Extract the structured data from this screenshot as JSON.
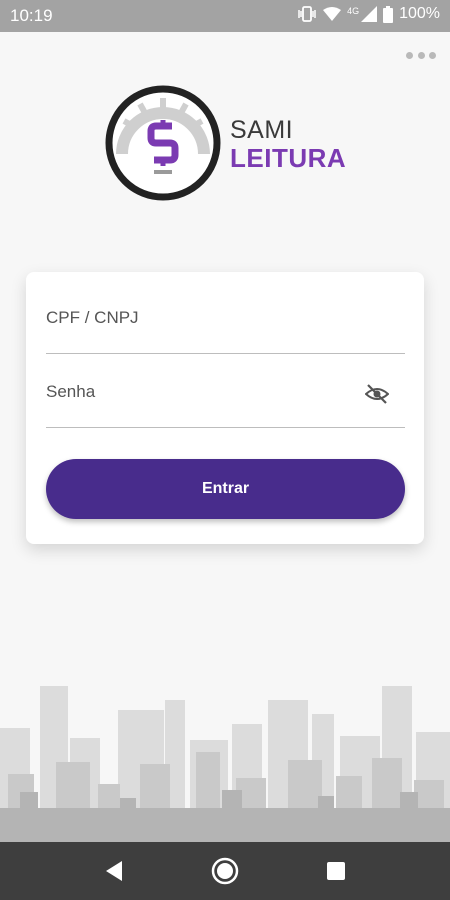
{
  "status_bar": {
    "time": "10:19",
    "network_label": "4G",
    "battery_percent": "100%",
    "icons": [
      "vibrate-icon",
      "wifi-icon",
      "signal-icon",
      "battery-icon"
    ]
  },
  "toolbar": {
    "overflow_icon": "more-horiz-icon"
  },
  "logo": {
    "line1": "SAMI",
    "line2": "LEITURA",
    "icon": "meter-dollar-icon",
    "colors": {
      "primary": "#7b3bb2",
      "ring": "#222222"
    }
  },
  "login": {
    "cpf_placeholder": "CPF / CNPJ",
    "password_placeholder": "Senha",
    "password_toggle_icon": "eye-off-icon",
    "submit_label": "Entrar",
    "submit_color": "#482c8c"
  },
  "nav_bar": {
    "icons": [
      "back-icon",
      "home-icon",
      "recents-icon"
    ]
  }
}
